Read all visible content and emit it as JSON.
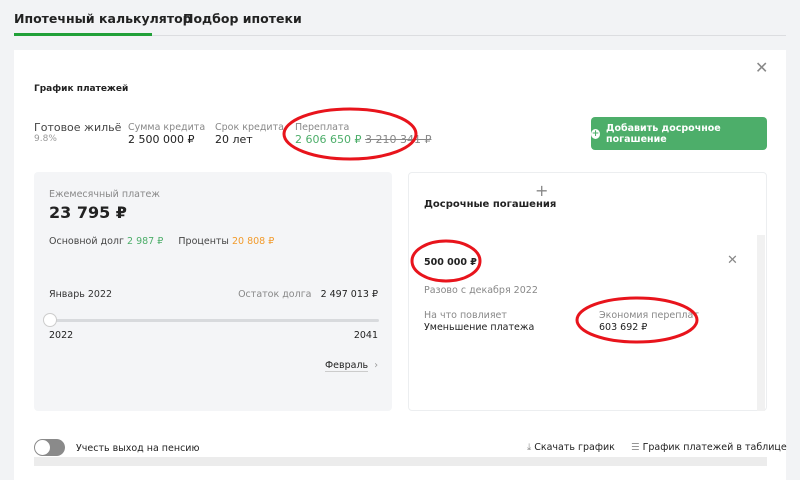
{
  "tabs": [
    {
      "label": "Ипотечный калькулятор",
      "active": true
    },
    {
      "label": "Подбор ипотеки",
      "active": false
    }
  ],
  "accent": "#21a038",
  "title": "График платежей",
  "summary": {
    "program": "Готовое жильё",
    "rate": "9.8%",
    "loan_label": "Сумма кредита",
    "loan_value": "2 500 000 ₽",
    "term_label": "Срок кредита",
    "term_value": "20 лет",
    "overpay_label": "Переплата",
    "overpay_new": "2 606 650 ₽",
    "overpay_old": "3 210 341 ₽"
  },
  "add_button": "Добавить досрочное погашение",
  "monthly": {
    "label": "Ежемесячный платеж",
    "value": "23 795 ₽",
    "principal_label": "Основной долг",
    "principal_value": "2 987 ₽",
    "interest_label": "Проценты",
    "interest_value": "20 808 ₽",
    "month": "Январь 2022",
    "balance_label": "Остаток долга",
    "balance_value": "2 497 013 ₽",
    "slider_min": "2022",
    "slider_max": "2041",
    "slider_position": 0,
    "next_label": "Февраль"
  },
  "early": {
    "title": "Досрочные погашения",
    "amount": "500 000 ₽",
    "schedule": "Разово с декабря 2022",
    "affects_label": "На что повлияет",
    "affects_value": "Уменьшение платежа",
    "savings_label": "Экономия переплат",
    "savings_value": "603 692 ₽"
  },
  "footer": {
    "pension_label": "Учесть выход на пенсию",
    "pension_on": false,
    "download_label": "Скачать график",
    "table_label": "График платежей в таблице"
  },
  "annotation_color": "#e8141c"
}
